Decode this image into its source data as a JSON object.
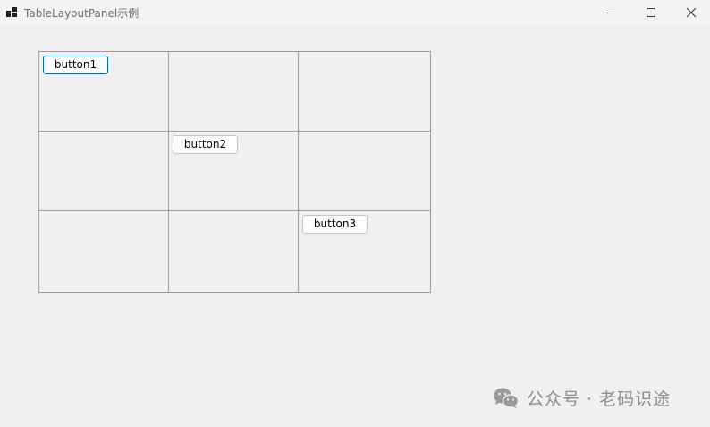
{
  "window": {
    "title": "TableLayoutPanel示例",
    "icon": "app-window-icon",
    "controls": [
      "minimize-icon",
      "maximize-icon",
      "close-icon"
    ]
  },
  "table_layout_panel": {
    "rows": 3,
    "columns": 3,
    "buttons": [
      {
        "label": "button1",
        "row": 0,
        "column": 0,
        "focused": true
      },
      {
        "label": "button2",
        "row": 1,
        "column": 1,
        "focused": false
      },
      {
        "label": "button3",
        "row": 2,
        "column": 2,
        "focused": false
      }
    ]
  },
  "watermark": {
    "text": "公众号 · 老码识途",
    "icon": "wechat-icon"
  },
  "colors": {
    "background": "#f0f0f0",
    "grid_lines": "#9c9c9c",
    "focus_border": "#0067c0"
  }
}
